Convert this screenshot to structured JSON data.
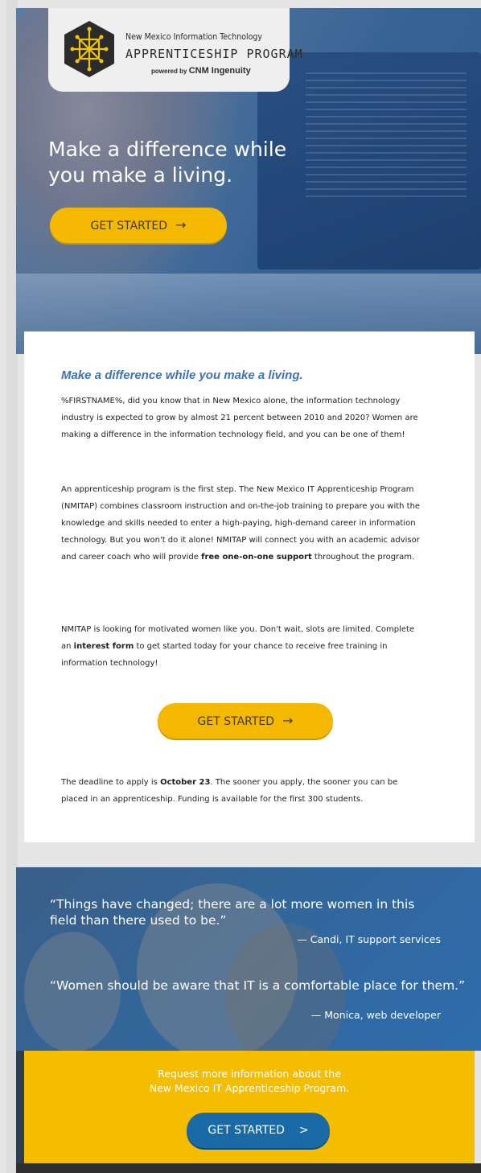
{
  "logo": {
    "line1": "New Mexico Information Technology",
    "line2": "APPRENTICESHIP PROGRAM",
    "line3_prefix": "powered by",
    "line3_brand": "CNM Ingenuity"
  },
  "hero": {
    "title": "Make a difference while you make a living.",
    "button_label": "GET STARTED",
    "button_arrow": "→"
  },
  "intro": {
    "headline": "Make a difference while you make a living.",
    "p1": "%FIRSTNAME%, did you know that in New Mexico alone, the information technology industry is expected to grow by almost 21 percent between 2010 and 2020? Women are making a difference in the information technology field, and you can be one of them!",
    "p2_start": "An apprenticeship program is the first step. The New Mexico IT Apprenticeship Program (NMITAP) combines classroom instruction and on-the-job training to prepare you with the knowledge and skills needed to enter a high-paying, high-demand career in information technology. But you won't do it alone! NMITAP will connect you with an academic advisor and career coach who will provide ",
    "p2_bold": "free one-on-one support",
    "p2_end": " throughout the program.",
    "p3_start": "NMITAP is looking for motivated women like you. Don't wait, slots are limited. Complete an ",
    "p3_bold": "interest form",
    "p3_end": " to get started today for your chance to receive free training in information technology!",
    "button_label": "GET STARTED",
    "button_arrow": "→",
    "p4_start": "The deadline to apply is ",
    "p4_bold": "October 23",
    "p4_end": ". The sooner you apply, the sooner you can be placed in an apprenticeship. Funding is available for the first 300 students."
  },
  "quotes": [
    {
      "text": "“Things have changed; there are a lot more women in this field than there used to be.”",
      "author": "— Candi, IT support services"
    },
    {
      "text": "“Women should be aware that IT is a comfortable place for them.”",
      "author": "— Monica, web developer"
    }
  ],
  "footer": {
    "line1": "Request more information about the",
    "line2": "New Mexico IT Apprenticeship Program.",
    "button_label": "GET STARTED",
    "button_arrow": ">"
  },
  "colors": {
    "accent_yellow": "#f5b800",
    "accent_blue": "#1a6aa6",
    "headline_blue": "#3e72b4"
  }
}
